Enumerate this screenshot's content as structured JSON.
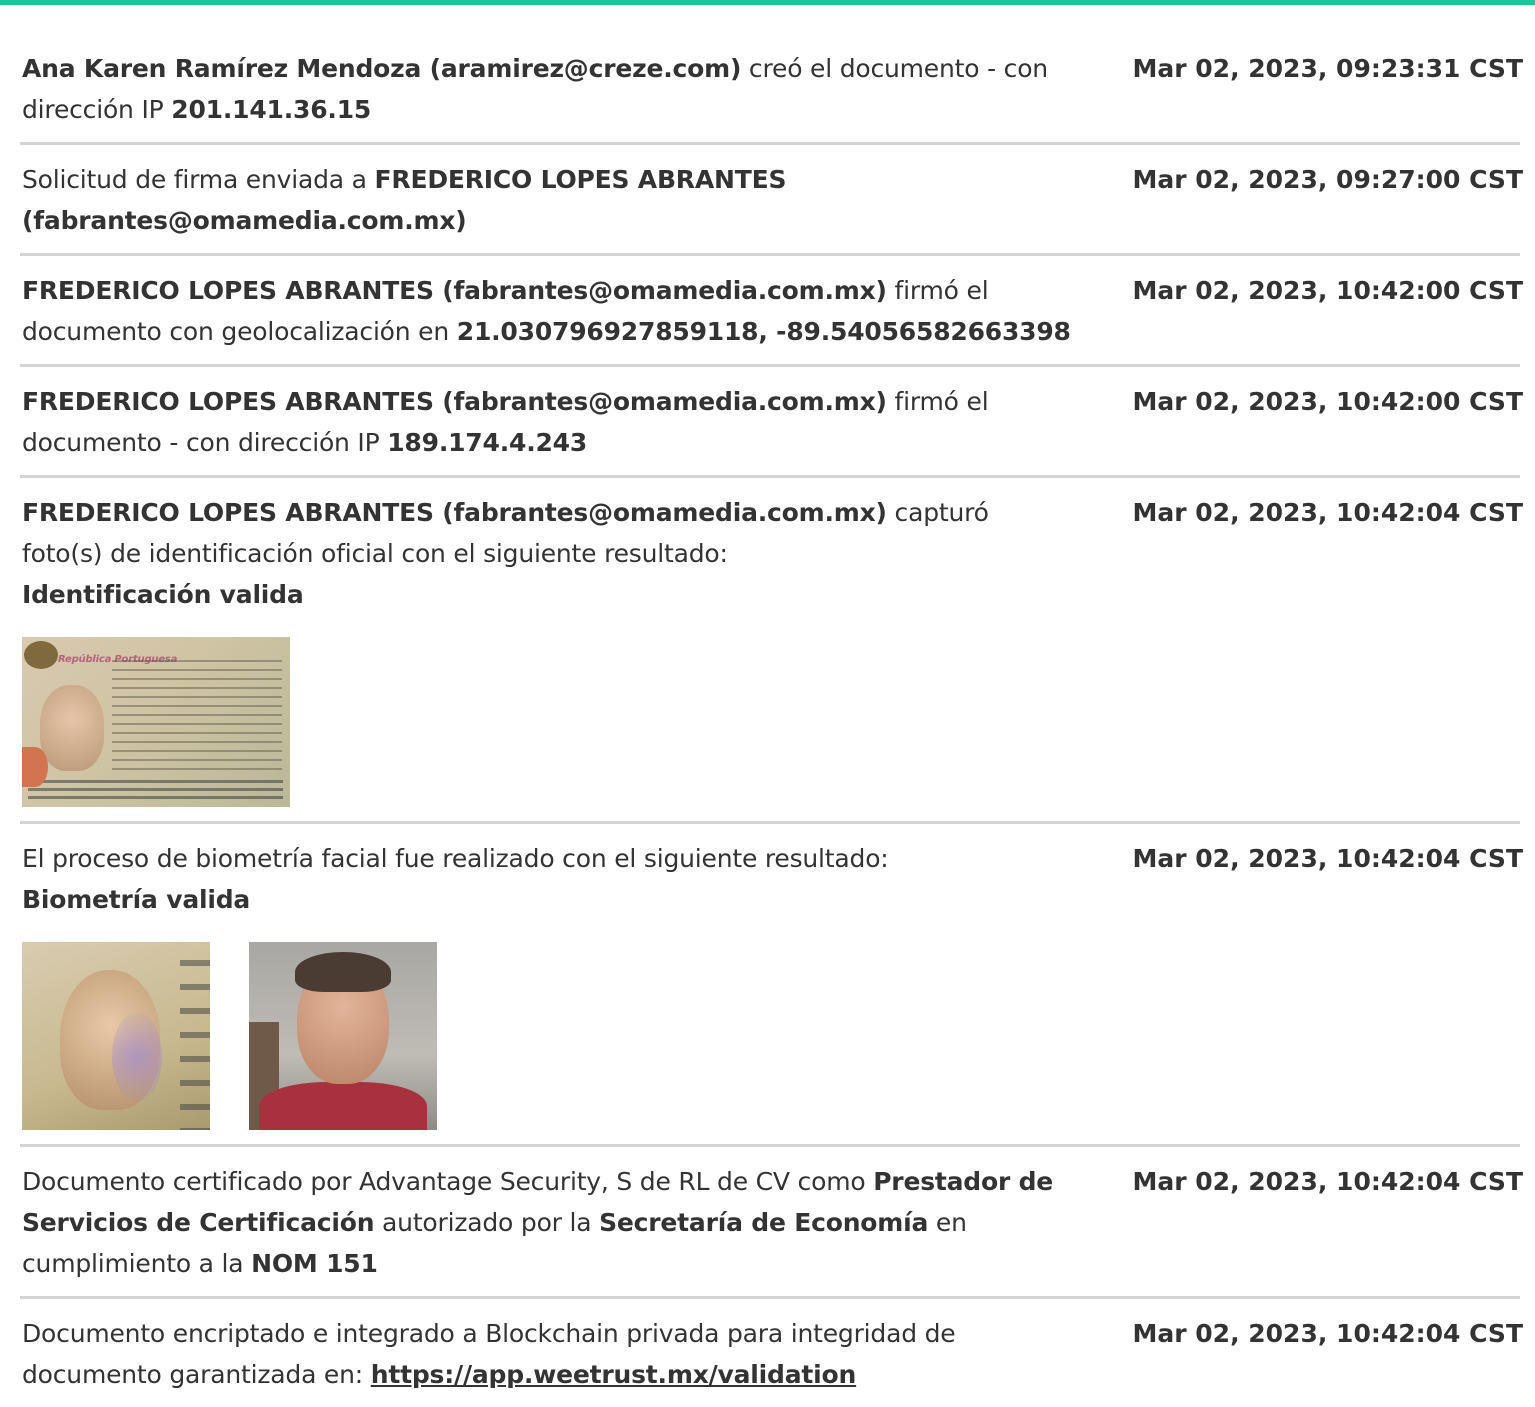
{
  "accent_color": "#19c79a",
  "events": [
    {
      "parts": [
        {
          "t": "Ana Karen Ramírez Mendoza (aramirez@creze.com)",
          "b": true
        },
        {
          "t": " creó el documento - con dirección IP ",
          "b": false
        },
        {
          "t": "201.141.36.15",
          "b": true
        }
      ],
      "timestamp": "Mar 02, 2023, 09:23:31 CST"
    },
    {
      "parts": [
        {
          "t": "Solicitud de firma enviada a ",
          "b": false
        },
        {
          "t": "FREDERICO LOPES ABRANTES (fabrantes@omamedia.com.mx)",
          "b": true
        }
      ],
      "timestamp": "Mar 02, 2023, 09:27:00 CST"
    },
    {
      "parts": [
        {
          "t": "FREDERICO LOPES ABRANTES (fabrantes@omamedia.com.mx)",
          "b": true
        },
        {
          "t": " firmó el documento con geolocalización en ",
          "b": false
        },
        {
          "t": "21.030796927859118, -89.54056582663398",
          "b": true
        }
      ],
      "timestamp": "Mar 02, 2023, 10:42:00 CST"
    },
    {
      "parts": [
        {
          "t": "FREDERICO LOPES ABRANTES (fabrantes@omamedia.com.mx)",
          "b": true
        },
        {
          "t": " firmó el documento - con dirección IP ",
          "b": false
        },
        {
          "t": "189.174.4.243",
          "b": true
        }
      ],
      "timestamp": "Mar 02, 2023, 10:42:00 CST"
    },
    {
      "parts": [
        {
          "t": "FREDERICO LOPES ABRANTES (fabrantes@omamedia.com.mx)",
          "b": true
        },
        {
          "t": " capturó foto(s) de identificación oficial con el siguiente resultado:",
          "b": false
        }
      ],
      "result": "Identificación valida",
      "timestamp": "Mar 02, 2023, 10:42:04 CST"
    },
    {
      "parts": [
        {
          "t": "El proceso de biometría facial fue realizado con el siguiente resultado:",
          "b": false
        }
      ],
      "result": "Biometría valida",
      "timestamp": "Mar 02, 2023, 10:42:04 CST"
    },
    {
      "parts": [
        {
          "t": "Documento certificado por Advantage Security, S de RL de CV como ",
          "b": false
        },
        {
          "t": "Prestador de Servicios de Certificación",
          "b": true
        },
        {
          "t": " autorizado por la ",
          "b": false
        },
        {
          "t": "Secretaría de Economía",
          "b": true
        },
        {
          "t": " en cumplimiento a la ",
          "b": false
        },
        {
          "t": "NOM 151",
          "b": true
        }
      ],
      "timestamp": "Mar 02, 2023, 10:42:04 CST"
    },
    {
      "parts": [
        {
          "t": "Documento encriptado e integrado a Blockchain privada para integridad de documento garantizada en: ",
          "b": false
        }
      ],
      "link": "https://app.weetrust.mx/validation",
      "timestamp": "Mar 02, 2023, 10:42:04 CST"
    }
  ],
  "passport_photo": {
    "header_text": "República Portuguesa"
  }
}
